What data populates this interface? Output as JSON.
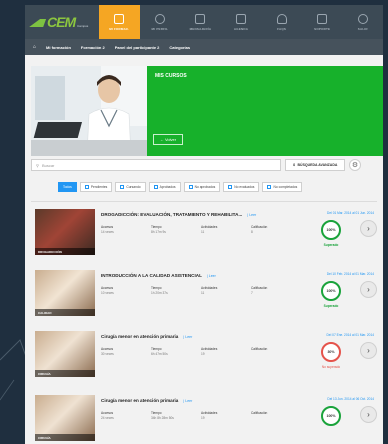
{
  "header": {
    "logo_text": "CEM",
    "logo_sub": "Campus",
    "nav": [
      {
        "label": "MI FORMAC.",
        "active": true
      },
      {
        "label": "MI PERFIL",
        "active": false
      },
      {
        "label": "MENSAJERÍA",
        "active": false
      },
      {
        "label": "AGENDA",
        "active": false
      },
      {
        "label": "FAQS",
        "active": false
      },
      {
        "label": "SOPORTE",
        "active": false
      },
      {
        "label": "SALIR",
        "active": false
      }
    ]
  },
  "subnav": {
    "items": [
      "Mi formación",
      "Formación 2",
      "Panel del participante 2",
      "Categorías"
    ]
  },
  "hero": {
    "title": "MIS CURSOS",
    "back_label": "← Volver"
  },
  "search": {
    "placeholder": "Buscar",
    "advanced_label": "BÚSQUEDA AVANZADA"
  },
  "filters": [
    "Todos",
    "Pendientes",
    "Cursando",
    "Aprobados",
    "No aprobados",
    "No evaluados",
    "No completados"
  ],
  "courses": [
    {
      "title": "DROGADICCIÓN: EVALUACIÓN, TRATAMIENTO Y REHABILITA...",
      "link": "| Leer",
      "acceso_label": "Accesos",
      "acceso_value": "14 veces",
      "tiempo_label": "Tiempo",
      "tiempo_value": "8h 17m 9s",
      "actividades_label": "Actividades",
      "actividades_value": "11",
      "calificacion_label": "Calificación",
      "calificacion_value": "8",
      "dates": "Del 01 Mar. 2014 al 01 Jun. 2014",
      "progress": "100%",
      "status": "Superado",
      "status_color": "#1aa33b",
      "thumb_label": "DROGADICCIÓN"
    },
    {
      "title": "INTRODUCCIÓN A LA CALIDAD ASISTENCIAL",
      "link": "| Leer",
      "acceso_label": "Accesos",
      "acceso_value": "10 veces",
      "tiempo_label": "Tiempo",
      "tiempo_value": "1h 20m 37s",
      "actividades_label": "Actividades",
      "actividades_value": "11",
      "calificacion_label": "Calificación",
      "calificacion_value": "7",
      "dates": "Del 10 Feb. 2014 al 01 Mar. 2014",
      "progress": "100%",
      "status": "Superado",
      "status_color": "#1aa33b",
      "thumb_label": "CALIDAD"
    },
    {
      "title": "Cirugía menor en atención primaria",
      "link": "| Leer",
      "acceso_label": "Accesos",
      "acceso_value": "30 veces",
      "tiempo_label": "Tiempo",
      "tiempo_value": "6h 47m 50s",
      "actividades_label": "Actividades",
      "actividades_value": "19",
      "calificacion_label": "Calificación",
      "calificacion_value": "",
      "dates": "Del 07 Ene. 2014 al 01 Mar. 2014",
      "progress": "30%",
      "status": "No superado",
      "status_color": "#e5534b",
      "thumb_label": "CIRUGÍA"
    },
    {
      "title": "Cirugía menor en atención primaria",
      "link": "| Leer",
      "acceso_label": "Accesos",
      "acceso_value": "24 veces",
      "tiempo_label": "Tiempo",
      "tiempo_value": "34h 8h 28m 50s",
      "actividades_label": "Actividades",
      "actividades_value": "19",
      "calificacion_label": "Calificación",
      "calificacion_value": "",
      "dates": "Del 13 Jun. 2014 al 06 Oct. 2014",
      "progress": "100%",
      "status": "",
      "status_color": "#1aa33b",
      "thumb_label": "CIRUGÍA"
    }
  ],
  "colors": {
    "accent_orange": "#f5a623",
    "hero_green": "#17b12b",
    "link_blue": "#2196f3",
    "dark_header": "#3c4a55"
  }
}
